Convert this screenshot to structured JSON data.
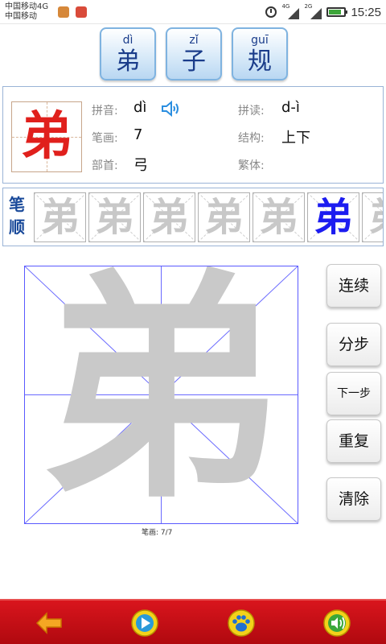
{
  "status_bar": {
    "carrier_line1": "中国移动4G",
    "carrier_line2": "中国移动",
    "network_1": "4G",
    "network_2": "2G",
    "time": "15:25"
  },
  "words": [
    {
      "pinyin": "dì",
      "hanzi": "弟"
    },
    {
      "pinyin": "zǐ",
      "hanzi": "子"
    },
    {
      "pinyin": "guī",
      "hanzi": "规"
    }
  ],
  "info": {
    "character": "弟",
    "pinyin_label": "拼音:",
    "pinyin_value": "dì",
    "reading_label": "拼读:",
    "reading_value": "d-ì",
    "strokes_label": "笔画:",
    "strokes_value": "7",
    "structure_label": "结构:",
    "structure_value": "上下",
    "radical_label": "部首:",
    "radical_value": "弓",
    "traditional_label": "繁体:",
    "traditional_value": ""
  },
  "stroke_order": {
    "label_line1": "笔",
    "label_line2": "顺",
    "cells": [
      {
        "char": "弟",
        "state": "partial"
      },
      {
        "char": "弟",
        "state": "partial"
      },
      {
        "char": "弟",
        "state": "partial"
      },
      {
        "char": "弟",
        "state": "partial"
      },
      {
        "char": "弟",
        "state": "partial"
      },
      {
        "char": "弟",
        "state": "done"
      },
      {
        "char": "弟",
        "state": "partial"
      }
    ]
  },
  "practice": {
    "character": "弟",
    "stroke_count_text": "笔画:  7/7"
  },
  "buttons": {
    "continuous": "连续",
    "step": "分步",
    "next_step": "下一步",
    "repeat": "重复",
    "clear": "清除"
  },
  "bottom_bar": {
    "icons": [
      "back-arrow-icon",
      "play-icon",
      "paw-icon",
      "sound-icon"
    ]
  },
  "colors": {
    "accent_red": "#d9151d",
    "char_red": "#e0201c",
    "stroke_blue": "#1c1cf0",
    "word_text": "#1a3c8a"
  }
}
